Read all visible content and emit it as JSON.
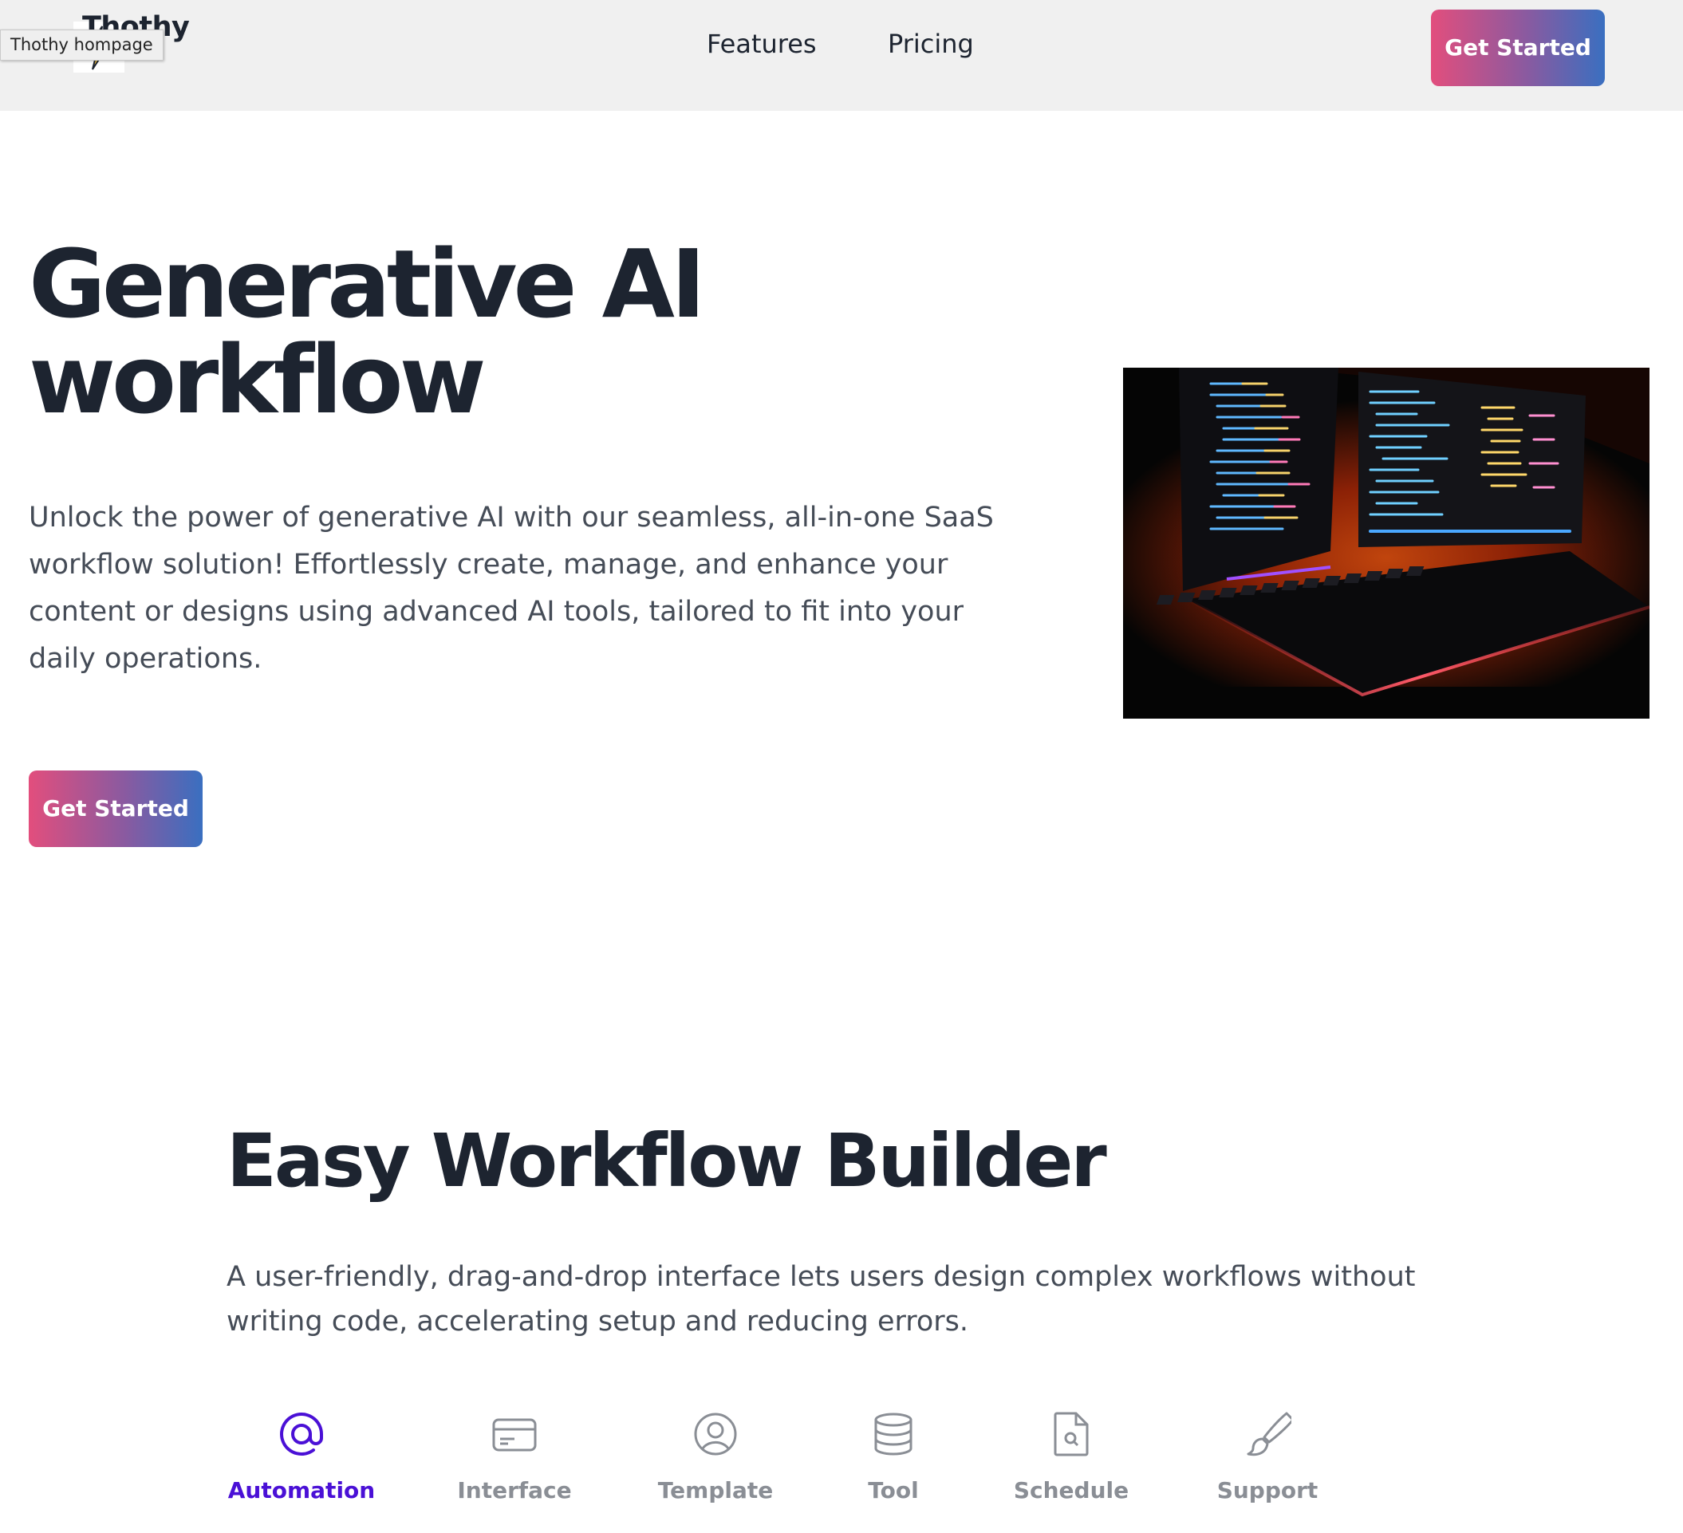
{
  "header": {
    "logo_text": "Thothy",
    "tooltip": "Thothy hompage",
    "nav": {
      "features": "Features",
      "pricing": "Pricing"
    },
    "cta_label": "Get Started"
  },
  "hero": {
    "title_line1": "Generative AI",
    "title_line2": "workflow",
    "description": "Unlock the power of generative AI with our seamless, all-in-one SaaS workflow solution! Effortlessly create, manage, and enhance your content or designs using advanced AI tools, tailored to fit into your daily operations.",
    "cta_label": "Get Started",
    "image": "photo-computer-monitors-keyboard"
  },
  "section": {
    "title": "Easy Workflow Builder",
    "description": "A user-friendly, drag-and-drop interface lets users design complex workflows without writing code, accelerating setup and reducing errors.",
    "tabs": [
      {
        "label": "Automation",
        "icon": "at-sign-icon",
        "active": true
      },
      {
        "label": "Interface",
        "icon": "card-icon",
        "active": false
      },
      {
        "label": "Template",
        "icon": "user-circle-icon",
        "active": false
      },
      {
        "label": "Tool",
        "icon": "database-icon",
        "active": false
      },
      {
        "label": "Schedule",
        "icon": "file-search-icon",
        "active": false
      },
      {
        "label": "Support",
        "icon": "brush-icon",
        "active": false
      }
    ]
  },
  "colors": {
    "accent": "#4a10d6",
    "gradient_start": "#e24e7d",
    "gradient_end": "#3a6fc0",
    "heading": "#1d2430",
    "header_bg": "#f0f0f0"
  }
}
